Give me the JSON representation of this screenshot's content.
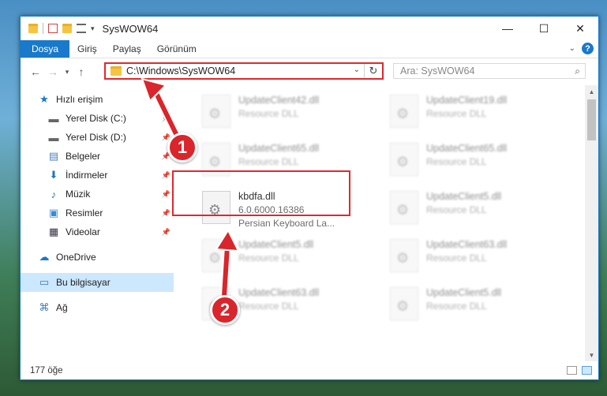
{
  "window": {
    "title": "SysWOW64"
  },
  "ribbon": {
    "tabs": [
      "Dosya",
      "Giriş",
      "Paylaş",
      "Görünüm"
    ]
  },
  "address": {
    "path": "C:\\Windows\\SysWOW64"
  },
  "search": {
    "placeholder": "Ara: SysWOW64"
  },
  "sidebar": {
    "quick_access": "Hızlı erişim",
    "items": [
      {
        "label": "Yerel Disk (C:)",
        "icon": "drive-icon"
      },
      {
        "label": "Yerel Disk (D:)",
        "icon": "drive-icon"
      },
      {
        "label": "Belgeler",
        "icon": "documents-icon"
      },
      {
        "label": "İndirmeler",
        "icon": "download-icon"
      },
      {
        "label": "Müzik",
        "icon": "music-icon"
      },
      {
        "label": "Resimler",
        "icon": "pictures-icon"
      },
      {
        "label": "Videolar",
        "icon": "video-icon"
      }
    ],
    "onedrive": "OneDrive",
    "this_pc": "Bu bilgisayar",
    "network": "Ağ"
  },
  "files": {
    "left": [
      {
        "name": "UpdateClient42.dll",
        "sub": "Resource DLL"
      },
      {
        "name": "UpdateClient65.dll",
        "sub": "Resource DLL"
      },
      {
        "name": "kbdfa.dll",
        "sub": "6.0.6000.16386",
        "sub2": "Persian Keyboard La..."
      },
      {
        "name": "UpdateClient5.dll",
        "sub": "Resource DLL"
      },
      {
        "name": "UpdateClient63.dll",
        "sub": "Resource DLL"
      }
    ],
    "right": [
      {
        "name": "UpdateClient19.dll",
        "sub": "Resource DLL"
      },
      {
        "name": "UpdateClient65.dll",
        "sub": "Resource DLL"
      },
      {
        "name": "UpdateClient5.dll",
        "sub": "Resource DLL"
      },
      {
        "name": "UpdateClient63.dll",
        "sub": "Resource DLL"
      },
      {
        "name": "UpdateClient5.dll",
        "sub": "Resource DLL"
      }
    ]
  },
  "status": {
    "count": "177 öğe"
  },
  "callouts": {
    "one": "1",
    "two": "2"
  },
  "colors": {
    "accent": "#1979ca",
    "highlight": "#e0282e",
    "callout": "#d9252b"
  }
}
